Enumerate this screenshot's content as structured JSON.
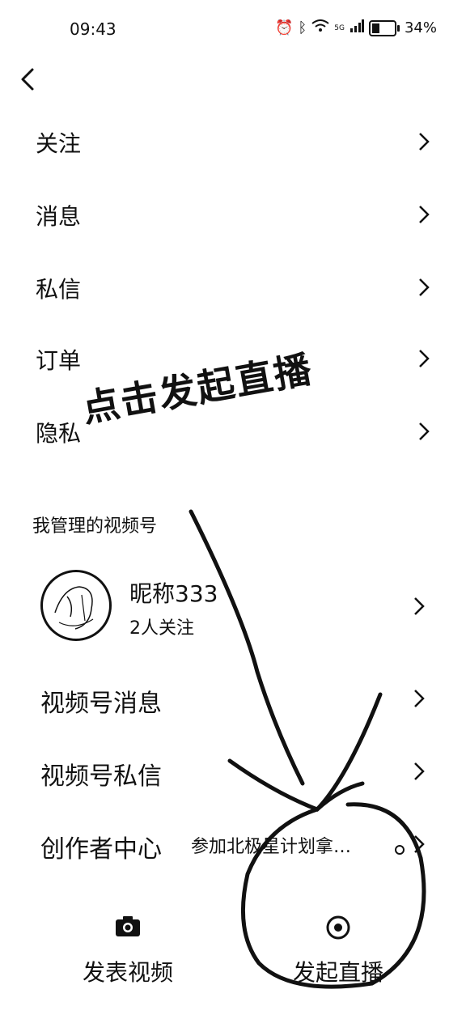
{
  "status_bar": {
    "time": "09:43",
    "network": "5G",
    "battery": "34%"
  },
  "menu": {
    "items": [
      {
        "label": "关注"
      },
      {
        "label": "消息"
      },
      {
        "label": "私信"
      },
      {
        "label": "订单"
      },
      {
        "label": "隐私"
      }
    ]
  },
  "channels": {
    "section_title": "我管理的视频号",
    "account": {
      "nickname": "昵称333",
      "followers": "2人关注"
    },
    "items": [
      {
        "label": "视频号消息"
      },
      {
        "label": "视频号私信"
      },
      {
        "label": "创作者中心",
        "hint": "参加北极星计划拿…"
      }
    ]
  },
  "bottom_actions": {
    "post_video": "发表视频",
    "start_live": "发起直播"
  },
  "annotation": {
    "text": "点击发起直播"
  }
}
